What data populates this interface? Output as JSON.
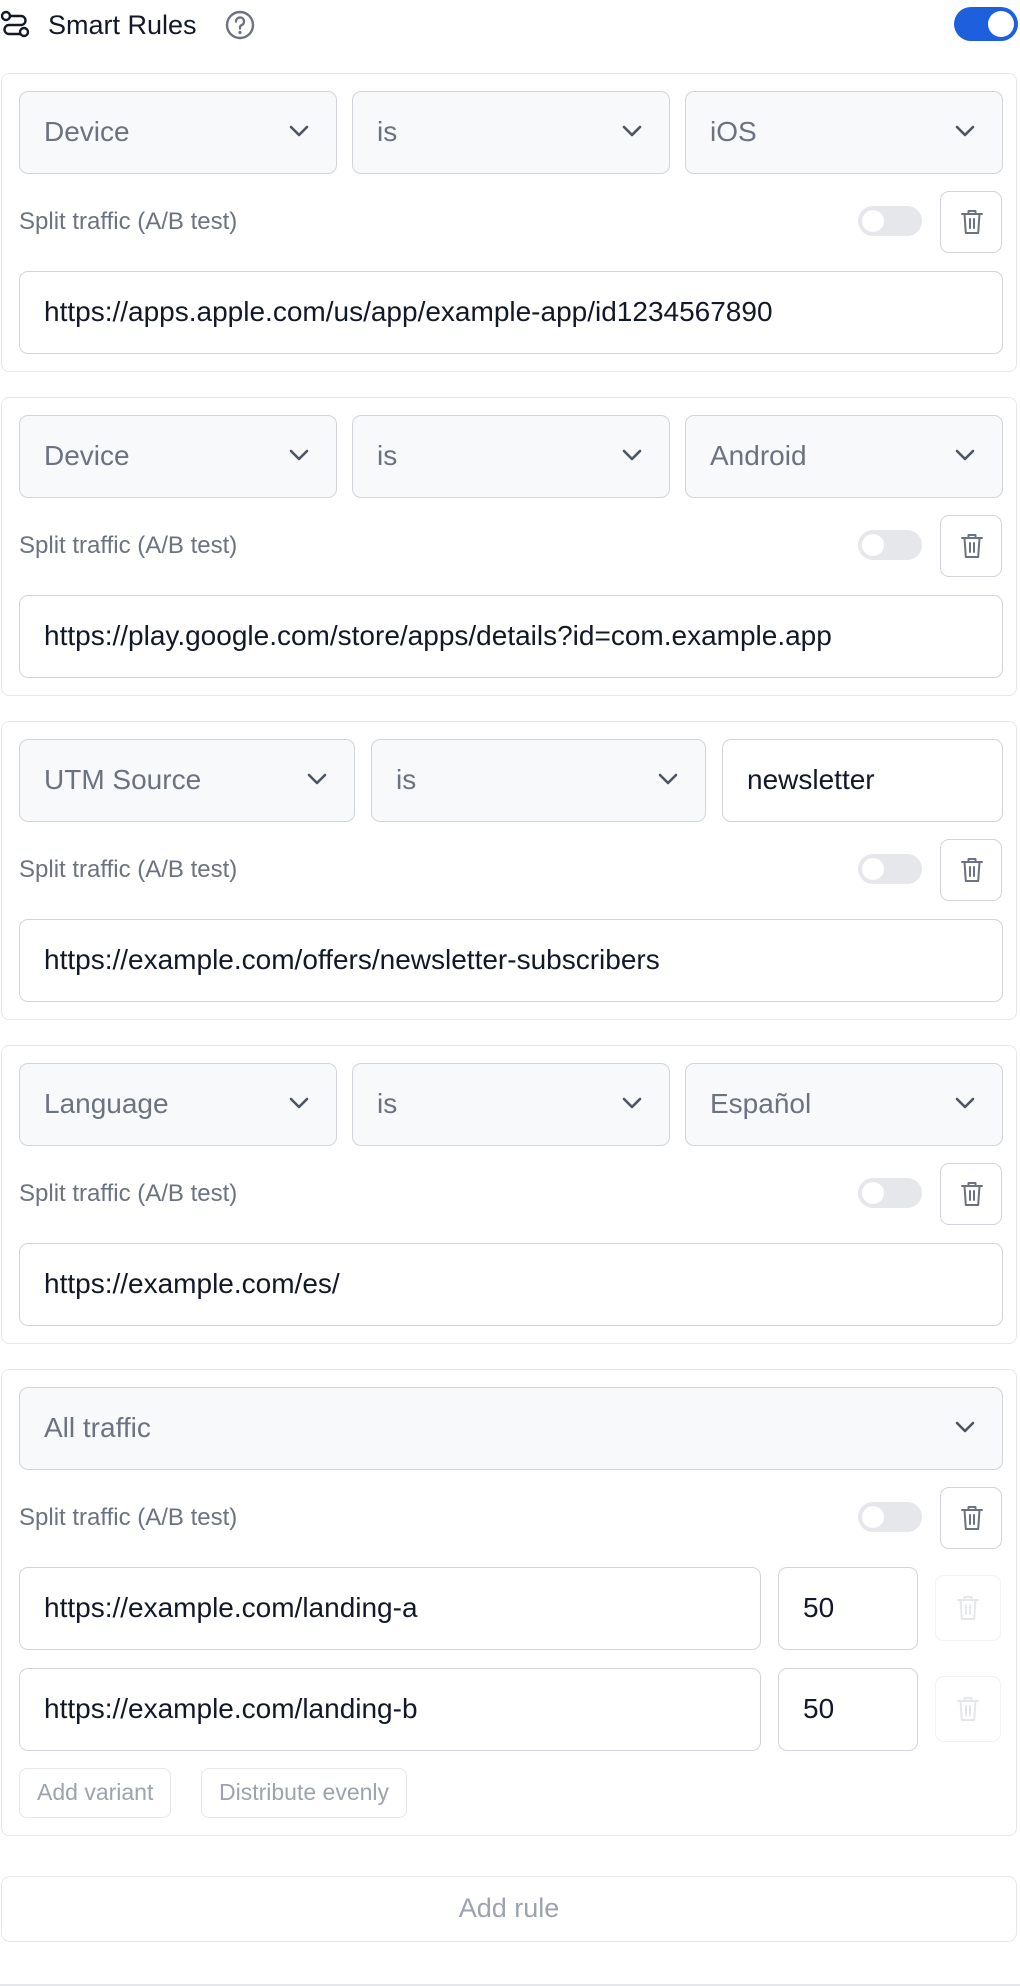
{
  "header": {
    "title": "Smart Rules",
    "route_icon": "route-icon",
    "help_icon": "help-circle-icon",
    "enabled": true,
    "accent_color": "#1d5fdc"
  },
  "split_label": "Split traffic (A/B test)",
  "rules": [
    {
      "field": "Device",
      "operator": "is",
      "value": "iOS",
      "split_enabled": false,
      "url": "https://apps.apple.com/us/app/example-app/id1234567890"
    },
    {
      "field": "Device",
      "operator": "is",
      "value": "Android",
      "split_enabled": false,
      "url": "https://play.google.com/store/apps/details?id=com.example.app"
    },
    {
      "field": "UTM Source",
      "operator": "is",
      "value": "newsletter",
      "split_enabled": false,
      "url": "https://example.com/offers/newsletter-subscribers"
    },
    {
      "field": "Language",
      "operator": "is",
      "value": "Español",
      "split_enabled": false,
      "url": "https://example.com/es/"
    },
    {
      "field": "All traffic",
      "split_enabled": false,
      "variants": [
        {
          "url": "https://example.com/landing-a",
          "weight": "50"
        },
        {
          "url": "https://example.com/landing-b",
          "weight": "50"
        }
      ],
      "add_variant_label": "Add variant",
      "distribute_label": "Distribute evenly"
    }
  ],
  "add_rule_label": "Add rule"
}
